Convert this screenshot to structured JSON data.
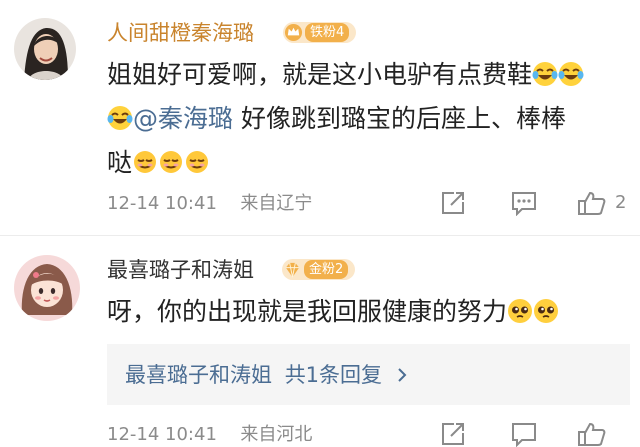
{
  "colors": {
    "accent_name": "#c9842d",
    "link": "#4b6d93",
    "meta": "#8b8b8b",
    "badge_gold": "#f2b04b"
  },
  "comments": [
    {
      "username": "人间甜橙秦海璐",
      "badge": "铁粉4",
      "badge_icon": "crown-icon",
      "text_line1": "姐姐好可爱啊，就是这小电驴有点费鞋",
      "mention": "@秦海璐",
      "text_line2_rest": "好像跳到璐宝的后座上、棒棒",
      "text_line3": "哒",
      "emoji_laugh": "laugh-cry-emoji",
      "emoji_sweat": "sweat-smile-emoji",
      "timestamp": "12-14 10:41",
      "location": "来自辽宁",
      "like_count": "2"
    },
    {
      "username": "最喜璐子和涛姐",
      "badge": "金粉2",
      "badge_icon": "gem-icon",
      "text": "呀，你的出现就是我回服健康的努力",
      "emoji_pleading": "pleading-face-emoji",
      "reply_author": "最喜璐子和涛姐",
      "reply_summary": "共1条回复",
      "timestamp": "12-14 10:41",
      "location": "来自河北"
    }
  ]
}
